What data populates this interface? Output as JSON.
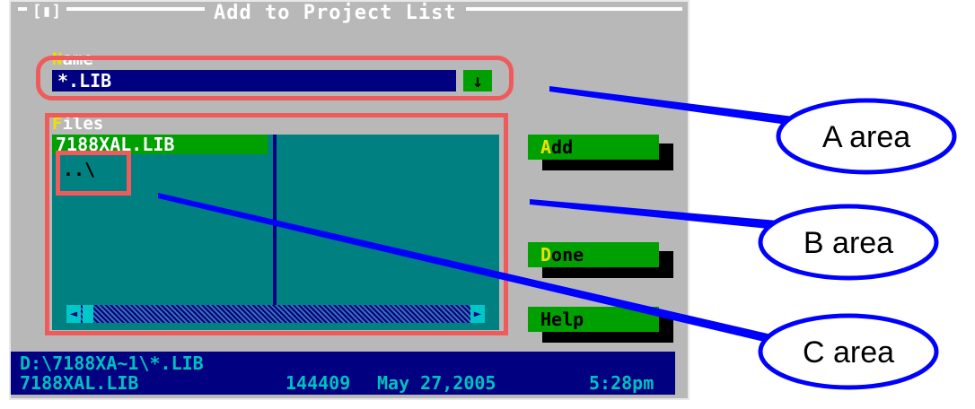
{
  "dialog": {
    "title": "Add to Project List",
    "close_box": "[▮]"
  },
  "name_field": {
    "label_hot": "N",
    "label_rest": "ame",
    "value": "*.LIB",
    "dropdown_arrow": "↓"
  },
  "files": {
    "label_hot": "F",
    "label_rest": "iles",
    "items": [
      "7188XAL.LIB",
      "..\\"
    ],
    "scroll_left": "◄",
    "scroll_right": "►"
  },
  "buttons": {
    "add": {
      "hot": "A",
      "rest": "dd"
    },
    "done": {
      "hot": "D",
      "rest": "one"
    },
    "help": {
      "hot": "",
      "rest": "Help"
    }
  },
  "status": {
    "path": "D:\\7188XA~1\\*.LIB",
    "file": "7188XAL.LIB",
    "size": "144409",
    "date": "May 27,2005",
    "time": "5:28pm"
  },
  "annotations": {
    "a": "A area",
    "b": "B area",
    "c": "C area"
  },
  "colors": {
    "annotation_box": "#ef5b5b",
    "callout": "#0000ff",
    "dialog_bg": "#b8b8b8",
    "list_bg": "#008080",
    "button_green": "#00a000",
    "status_bg": "#000080"
  }
}
